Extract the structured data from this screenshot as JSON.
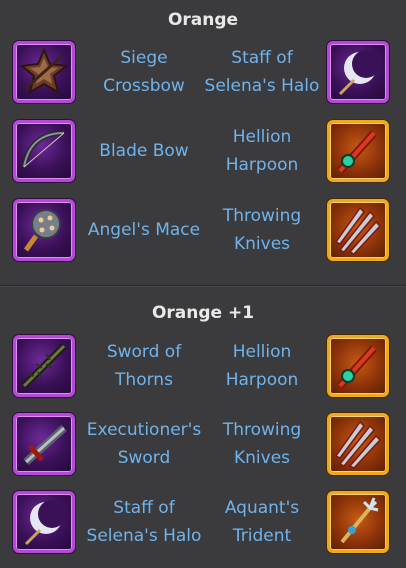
{
  "sections": [
    {
      "title": "Orange",
      "rows": [
        {
          "left": {
            "name": "Siege Crossbow",
            "icon": "siege-crossbow-icon",
            "tier_color": "#b64ad8"
          },
          "right": {
            "name": "Staff of Selena's Halo",
            "icon": "staff-of-selenas-halo-icon",
            "tier_color": "#b64ad8"
          }
        },
        {
          "left": {
            "name": "Blade Bow",
            "icon": "blade-bow-icon",
            "tier_color": "#b64ad8"
          },
          "right": {
            "name": "Hellion Harpoon",
            "icon": "hellion-harpoon-icon",
            "tier_color": "#f0a81f"
          }
        },
        {
          "left": {
            "name": "Angel's Mace",
            "icon": "angels-mace-icon",
            "tier_color": "#b64ad8"
          },
          "right": {
            "name": "Throwing Knives",
            "icon": "throwing-knives-icon",
            "tier_color": "#f0a81f"
          }
        }
      ]
    },
    {
      "title": "Orange +1",
      "rows": [
        {
          "left": {
            "name": "Sword of Thorns",
            "icon": "sword-of-thorns-icon",
            "tier_color": "#b64ad8"
          },
          "right": {
            "name": "Hellion Harpoon",
            "icon": "hellion-harpoon-icon",
            "tier_color": "#f0a81f"
          }
        },
        {
          "left": {
            "name": "Executioner's Sword",
            "icon": "executioners-sword-icon",
            "tier_color": "#b64ad8"
          },
          "right": {
            "name": "Throwing Knives",
            "icon": "throwing-knives-icon",
            "tier_color": "#f0a81f"
          }
        },
        {
          "left": {
            "name": "Staff of Selena's Halo",
            "icon": "staff-of-selenas-halo-icon",
            "tier_color": "#b64ad8"
          },
          "right": {
            "name": "Aquant's Trident",
            "icon": "aquants-trident-icon",
            "tier_color": "#f0a81f"
          }
        }
      ]
    }
  ],
  "colors": {
    "background": "#3b3b3d",
    "label": "#6fb3ec",
    "header": "#e9e9ea",
    "purple_tier": "#b64ad8",
    "orange_tier": "#f0a81f"
  }
}
